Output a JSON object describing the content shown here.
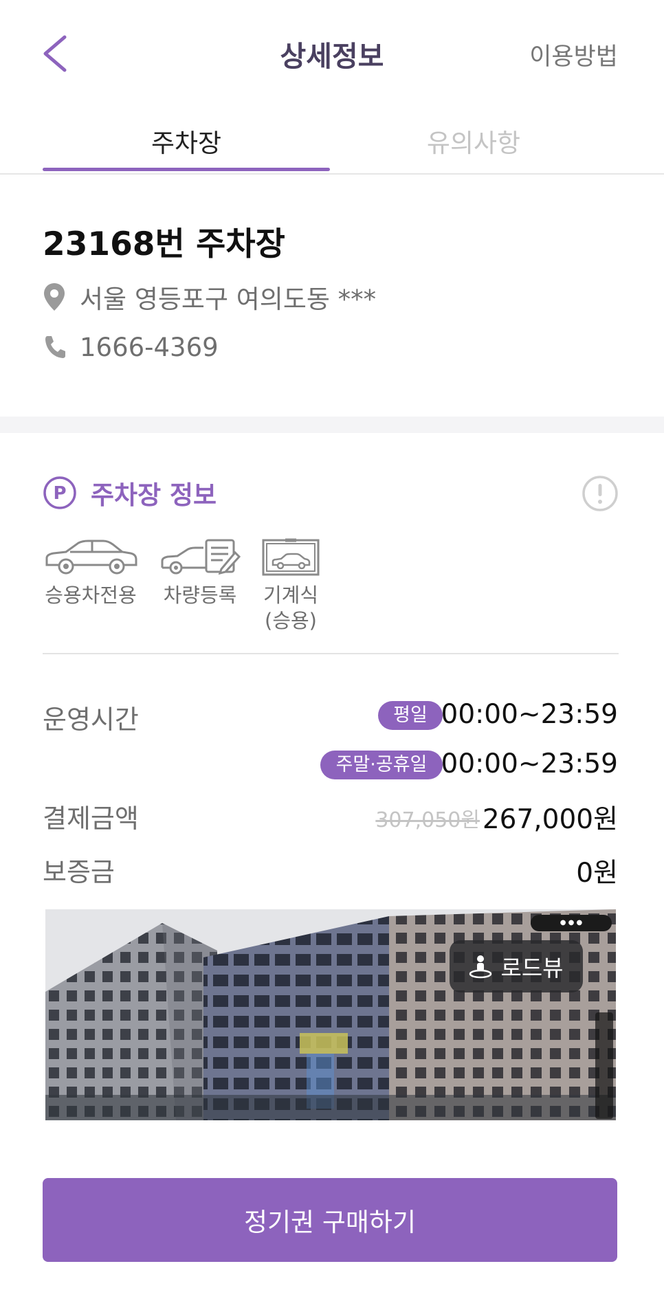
{
  "header": {
    "title": "상세정보",
    "help_link": "이용방법",
    "back_icon": "chevron-left-icon"
  },
  "tabs": [
    {
      "label": "주차장",
      "active": true
    },
    {
      "label": "유의사항",
      "active": false
    }
  ],
  "parking_lot": {
    "name": "23168번 주차장",
    "address": "서울 영등포구 여의도동 ***",
    "phone": "1666-4369"
  },
  "info_section": {
    "title": "주차장 정보",
    "features": [
      {
        "icon": "sedan-car-icon",
        "label_line1": "승용차전용",
        "label_line2": ""
      },
      {
        "icon": "car-registration-icon",
        "label_line1": "차량등록",
        "label_line2": ""
      },
      {
        "icon": "mechanical-parking-icon",
        "label_line1": "기계식",
        "label_line2": "(승용)"
      }
    ],
    "hours": {
      "label": "운영시간",
      "weekday_badge": "평일",
      "weekday_time": "00:00~23:59",
      "weekend_badge": "주말·공휴일",
      "weekend_time": "00:00~23:59"
    },
    "payment": {
      "label": "결제금액",
      "original_price": "307,050원",
      "price": "267,000원"
    },
    "deposit": {
      "label": "보증금",
      "value": "0원"
    }
  },
  "roadview": {
    "button_label": "로드뷰"
  },
  "cta": {
    "label": "정기권 구매하기"
  },
  "colors": {
    "accent": "#8d63bd",
    "title": "#4a4060",
    "muted": "#6f6f6f",
    "inactive": "#c4c4c4"
  }
}
